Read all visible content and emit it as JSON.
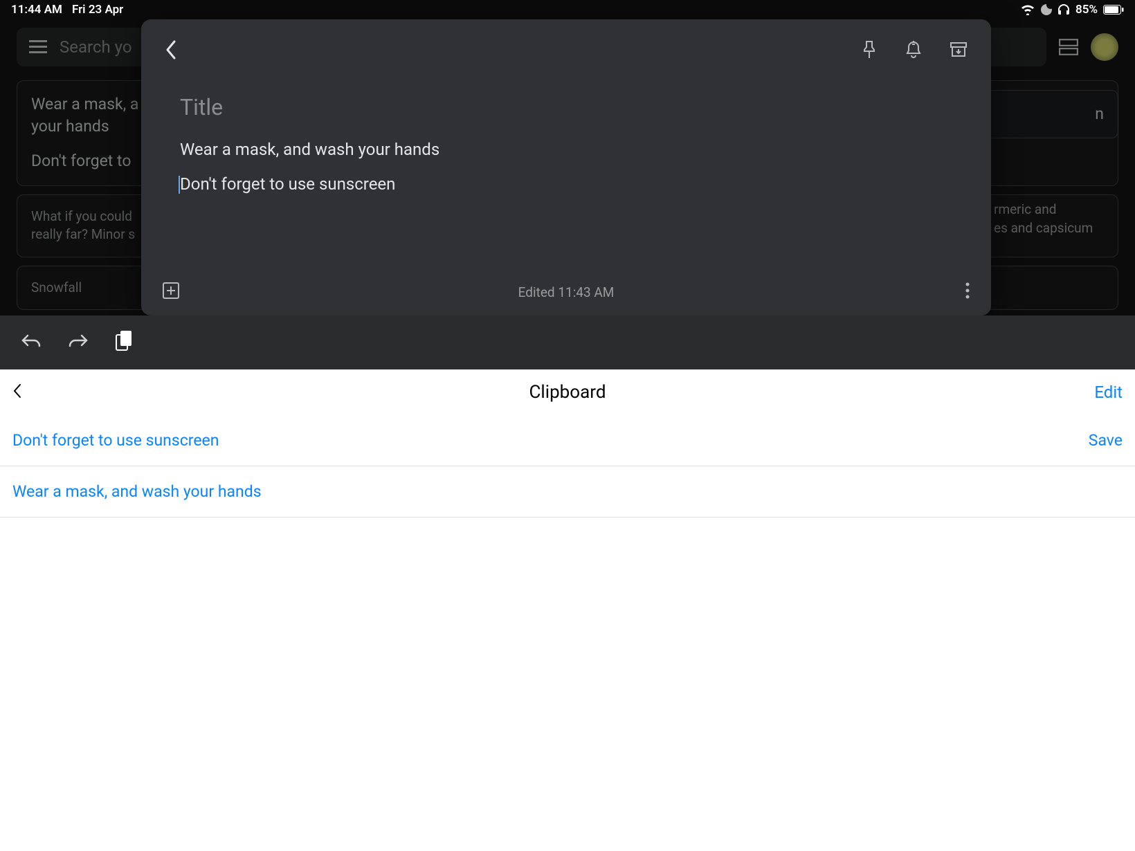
{
  "status": {
    "time": "11:44 AM",
    "date": "Fri 23 Apr",
    "battery": "85%"
  },
  "background": {
    "search_placeholder": "Search yo",
    "card1_line1": "Wear a mask, a",
    "card1_line2": "your hands",
    "card1_line3": "Don't forget to",
    "card2": "What if you could\nreally far? Minor s",
    "card3": "Snowfall",
    "right1": "n",
    "right2": "rmeric and\nes and capsicum"
  },
  "modal": {
    "title_placeholder": "Title",
    "line1": "Wear a mask, and wash your hands",
    "line2": "Don't forget to use sunscreen",
    "edited": "Edited 11:43 AM"
  },
  "clipboard": {
    "title": "Clipboard",
    "edit": "Edit",
    "item1": "Don't forget to use sunscreen",
    "save": "Save",
    "item2": "Wear a mask, and wash your hands"
  }
}
